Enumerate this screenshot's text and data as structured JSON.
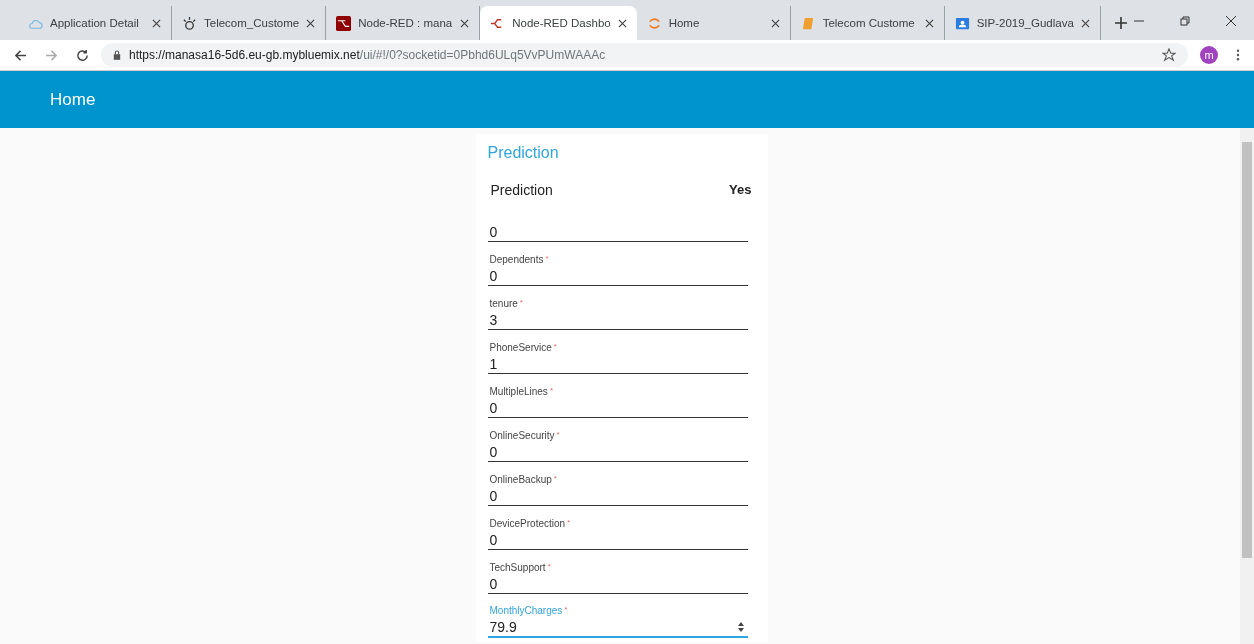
{
  "browser": {
    "tabs": [
      {
        "title": "Application Detail",
        "selected": false
      },
      {
        "title": "Telecom_Custome",
        "selected": false
      },
      {
        "title": "Node-RED : mana",
        "selected": false
      },
      {
        "title": "Node-RED Dashbo",
        "selected": true
      },
      {
        "title": "Home",
        "selected": false
      },
      {
        "title": "Telecom Custome",
        "selected": false
      },
      {
        "title": "SIP-2019_Gudlava",
        "selected": false
      }
    ],
    "url_host": "https://manasa16-5d6.eu-gb.mybluemix.net",
    "url_path": "/ui/#!/0?socketid=0Pbhd6ULq5VvPUmWAAAc",
    "profile_initial": "m"
  },
  "toolbar": {
    "title": "Home"
  },
  "card": {
    "title": "Prediction",
    "result_label": "Prediction",
    "result_value": "Yes",
    "fields": [
      {
        "value": "0",
        "focused": false
      },
      {
        "label": "Dependents",
        "required_mark": "*",
        "value": "0",
        "focused": false
      },
      {
        "label": "tenure",
        "required_mark": "*",
        "value": "3",
        "focused": false
      },
      {
        "label": "PhoneService",
        "required_mark": "*",
        "value": "1",
        "focused": false
      },
      {
        "label": "MultipleLines",
        "required_mark": "*",
        "value": "0",
        "focused": false
      },
      {
        "label": "OnlineSecurity",
        "required_mark": "*",
        "value": "0",
        "focused": false
      },
      {
        "label": "OnlineBackup",
        "required_mark": "*",
        "value": "0",
        "focused": false
      },
      {
        "label": "DeviceProtection",
        "required_mark": "*",
        "value": "0",
        "focused": false
      },
      {
        "label": "TechSupport",
        "required_mark": "*",
        "value": "0",
        "focused": false
      },
      {
        "label": "MonthlyCharges",
        "required_mark": "*",
        "value": "79.9",
        "focused": true
      }
    ]
  }
}
